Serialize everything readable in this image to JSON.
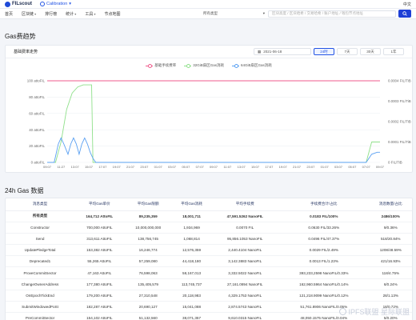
{
  "header": {
    "logo": "FILscout",
    "network": "Calibration",
    "language": "中文"
  },
  "nav": {
    "items": [
      "首页",
      "区块链",
      "排行榜",
      "统计",
      "工具",
      "节点地图"
    ],
    "dropdown_flags": [
      false,
      true,
      false,
      true,
      true,
      false
    ],
    "type_select": "所有类型",
    "search_placeholder": "区块高度 / 区块哈希 / 交易哈希 / 账户地址 / 钱包节点地址"
  },
  "page": {
    "section_title": "Gas费趋势",
    "table_title": "24h Gas 数据"
  },
  "chart_controls": {
    "subtitle": "基础费率走势",
    "date": "2021-06-18",
    "ranges": [
      "24时",
      "7天",
      "30天",
      "1年"
    ],
    "active_range": 0
  },
  "chart_data": {
    "type": "line",
    "legend_position": "top",
    "title": "",
    "left_axis": {
      "label": "",
      "ticks": [
        "100 attoFIL",
        "80 attoFIL",
        "60 attoFIL",
        "40 attoFIL",
        "20 attoFIL",
        "0 attoFIL"
      ],
      "ylim": [
        0,
        100
      ]
    },
    "right_axis": {
      "label": "",
      "ticks": [
        "0.0004 FIL/TiB",
        "0.0003 FIL/TiB",
        "0.0002 FIL/TiB",
        "0.0001 FIL/TiB",
        "0 FIL/TiB"
      ],
      "ylim": [
        0,
        0.0004
      ]
    },
    "x_ticks": [
      "09:07",
      "11:27",
      "13:07",
      "15:07",
      "17:07",
      "19:07",
      "21:07",
      "23:07",
      "01:07",
      "03:07",
      "05:07",
      "07:07",
      "09:07",
      "11:07",
      "13:07",
      "15:07",
      "17:07",
      "19:07",
      "21:07",
      "23:07",
      "01:07",
      "03:07",
      "05:07",
      "07:07",
      "09:07"
    ],
    "series": [
      {
        "name": "基础手续费率",
        "color": "#ef5b8c",
        "axis": "left",
        "x": [
          0,
          24
        ],
        "y": [
          100,
          100
        ]
      },
      {
        "name": "32GiB扇区Gas消耗",
        "color": "#8fe08a",
        "axis": "right",
        "x": [
          0,
          0.6,
          1.0,
          1.4,
          1.8,
          2.2,
          2.6,
          3.0,
          3.2,
          3.3,
          4.0,
          23.0,
          23.4,
          23.7,
          24.0
        ],
        "y": [
          0,
          0,
          0.0001,
          0.00026,
          0.00034,
          0.00037,
          0.00038,
          0.00038,
          0.00038,
          0,
          0,
          0,
          0.0001,
          0.0001,
          0.0001
        ]
      },
      {
        "name": "64GiB扇区Gas消耗",
        "color": "#5aa0f2",
        "axis": "right",
        "x": [
          0,
          0.5,
          0.8,
          1.0,
          1.2,
          1.5,
          1.7,
          1.9,
          2.1,
          2.3,
          2.5,
          2.7,
          2.9,
          3.1,
          3.3,
          3.5,
          23.0,
          23.4,
          23.8,
          24.0
        ],
        "y": [
          0,
          0,
          9e-05,
          0.00012,
          9e-05,
          4e-05,
          9e-05,
          0.00012,
          9e-05,
          4e-05,
          9e-05,
          0.00012,
          9e-05,
          5e-05,
          2e-05,
          0,
          0,
          4e-05,
          5e-05,
          5e-05
        ]
      }
    ]
  },
  "table": {
    "columns": [
      "消息类型",
      "平均Gas单价",
      "平均Gas限额",
      "平均Gas消耗",
      "平均手续费",
      "手续费合计/占比",
      "消息数量/占比"
    ],
    "rows": [
      [
        "所有类型",
        "164,712 AttoFIL",
        "89,235,359",
        "18,001,711",
        "47,591.5262 NanoFIL",
        "0.0183 FIL/100%",
        "2486/100%"
      ],
      [
        "Constructor",
        "700,000 AttoFIL",
        "10,000,000,000",
        "1,934,969",
        "0.0070 FIL",
        "0.0630 FIL/33.26%",
        "9/0.36%"
      ],
      [
        "Send",
        "313,611 AttoFIL",
        "138,756,745",
        "1,068,814",
        "95,856.1053 NanoFIL",
        "0.0496 FIL/47.37%",
        "518/20.84%"
      ],
      [
        "UpdatePledgeTotal",
        "153,382 AttoFIL",
        "16,246,774",
        "12,576,359",
        "2,440.4104 NanoFIL",
        "0.0029 FIL/2.49%",
        "1208/48.59%"
      ],
      [
        "Deprecated1",
        "55,265 AttoFIL",
        "57,259,080",
        "44,418,180",
        "3,142.3883 NanoFIL",
        "0.0013 FIL/1.23%",
        "421/16.93%"
      ],
      [
        "ProveCommitSector",
        "47,163 AttoFIL",
        "76,598,063",
        "58,167,013",
        "3,332.5022 NanoFIL",
        "393,233,2598 NanoFIL/0.33%",
        "118/4.75%"
      ],
      [
        "ChangeOwnerAddress",
        "177,380 AttoFIL",
        "135,405,579",
        "113,745,737",
        "27,161.0894 NanoFIL",
        "162,960.5964 NanoFIL/0.14%",
        "6/0.24%"
      ],
      [
        "OnEpochTickEnd",
        "179,200 AttoFIL",
        "27,310,548",
        "20,118,983",
        "4,329.1753 NanoFIL",
        "121,218.9099 NanoFIL/0.12%",
        "28/1.13%"
      ],
      [
        "SubmitWindowedPoSt",
        "182,287 AttoFIL",
        "20,690,127",
        "15,041,088",
        "2,874.5743 NanoFIL",
        "51,761.8906 NanoFIL/0.05%",
        "18/0.72%"
      ],
      [
        "PreCommitSector",
        "154,102 AttoFIL",
        "51,132,560",
        "38,071,357",
        "9,610.0315 NanoFIL",
        "48,050.1575 NanoFIL/0.04%",
        "5/0.20%"
      ]
    ]
  },
  "watermark": {
    "text": "IPFS联盟  星际联盟"
  }
}
